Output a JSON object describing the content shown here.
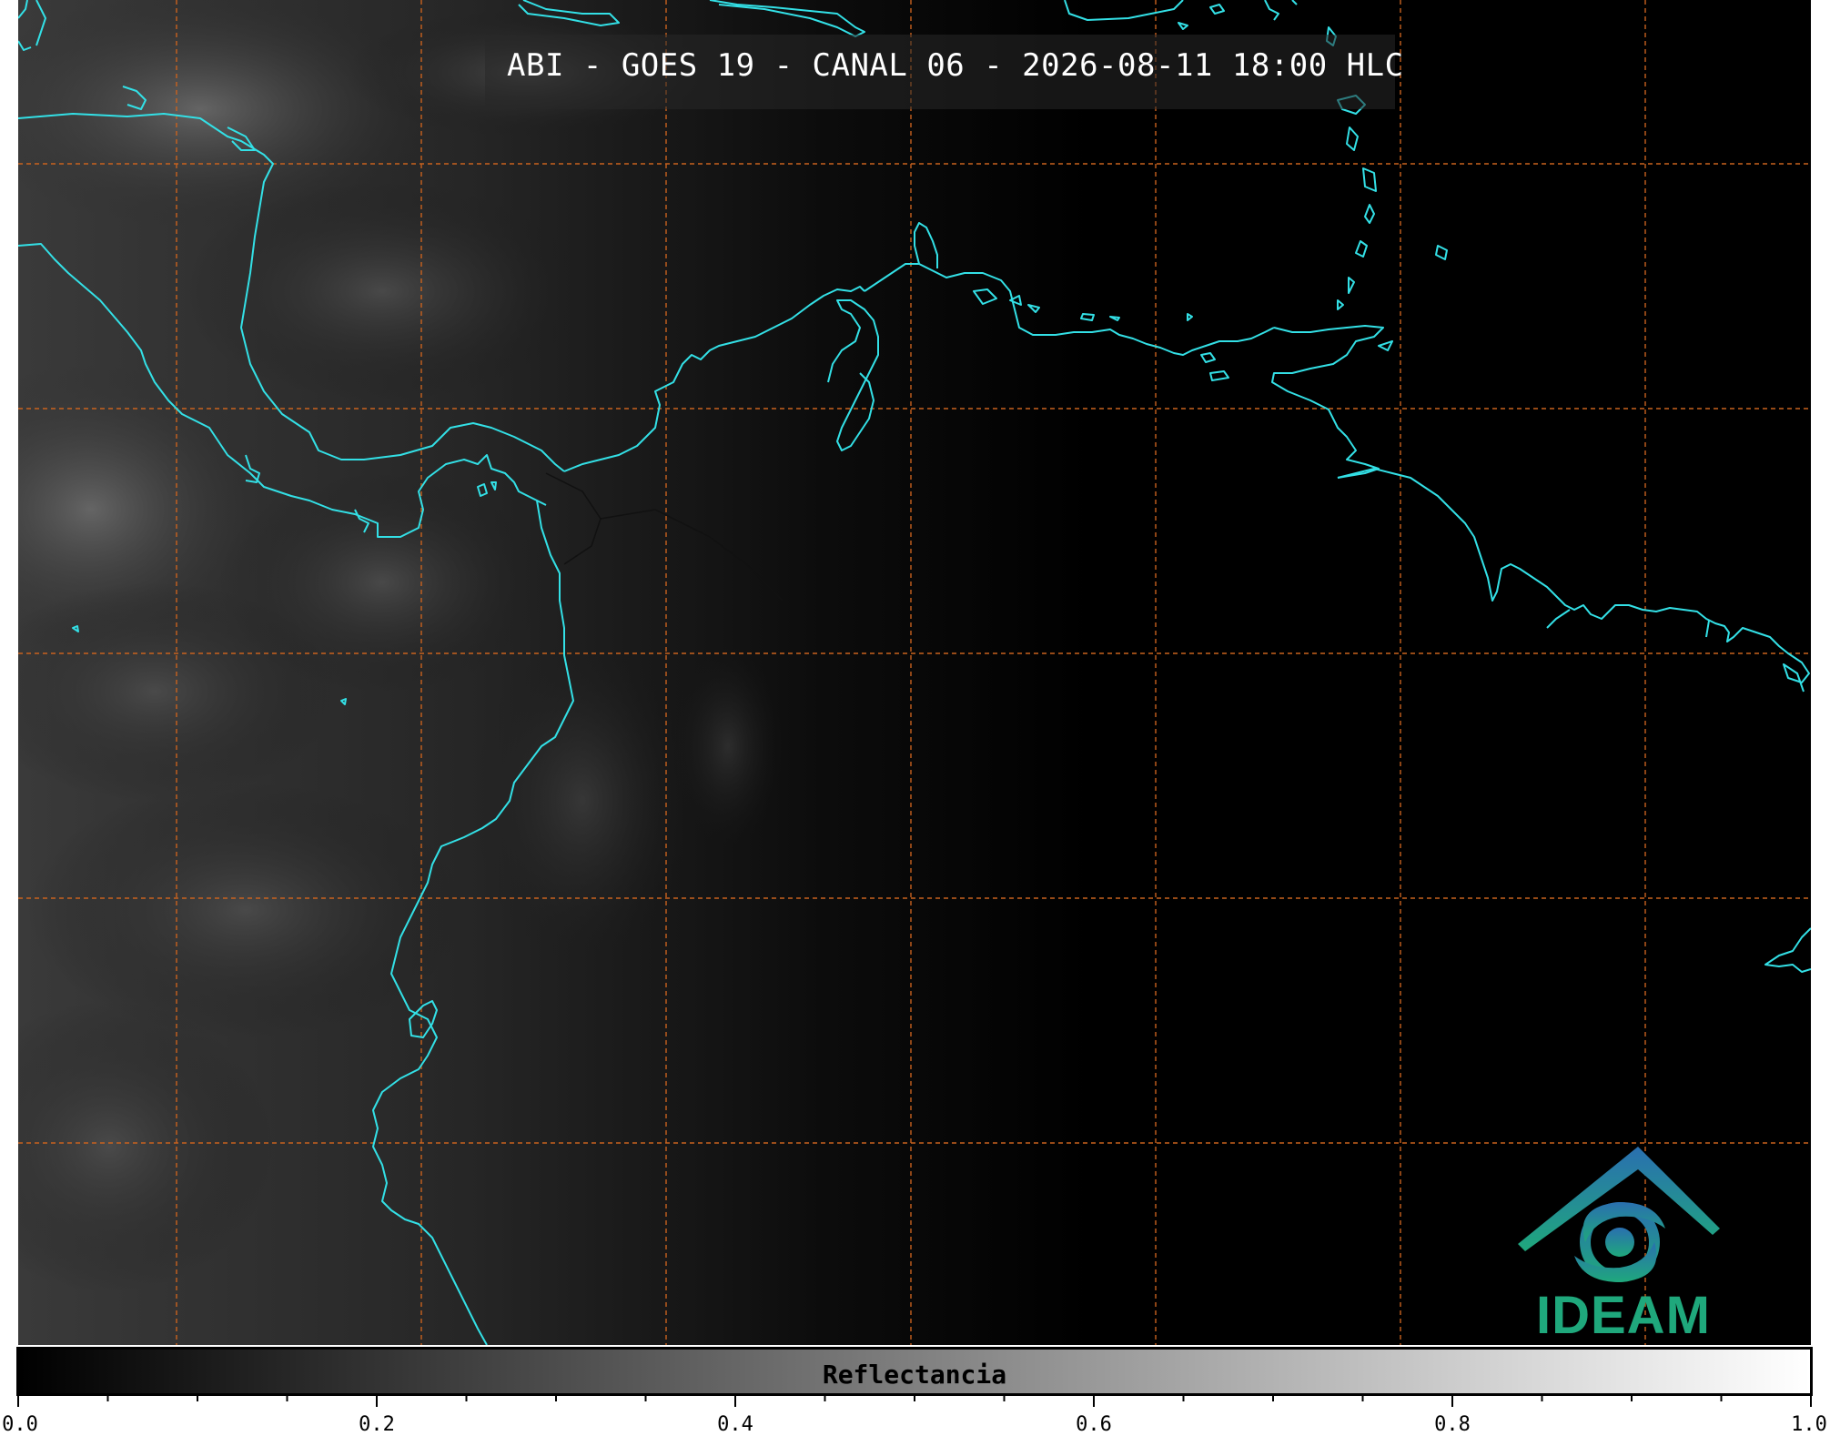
{
  "title": "ABI - GOES 19 - CANAL 06 - 2026-08-11 18:00 HLC",
  "logo": {
    "text": "IDEAM",
    "colors": [
      "#2a6fb0",
      "#1fa87c"
    ]
  },
  "colors": {
    "coastline": "#33e0e6",
    "grid": "#c9621e",
    "background": "#000000"
  },
  "colorbar": {
    "label": "Reflectancia",
    "min": 0.0,
    "max": 1.0,
    "gradient": [
      "#000000",
      "#ffffff"
    ],
    "major_ticks": [
      "0.0",
      "0.2",
      "0.4",
      "0.6",
      "0.8",
      "1.0"
    ],
    "minor_step": 0.05
  }
}
